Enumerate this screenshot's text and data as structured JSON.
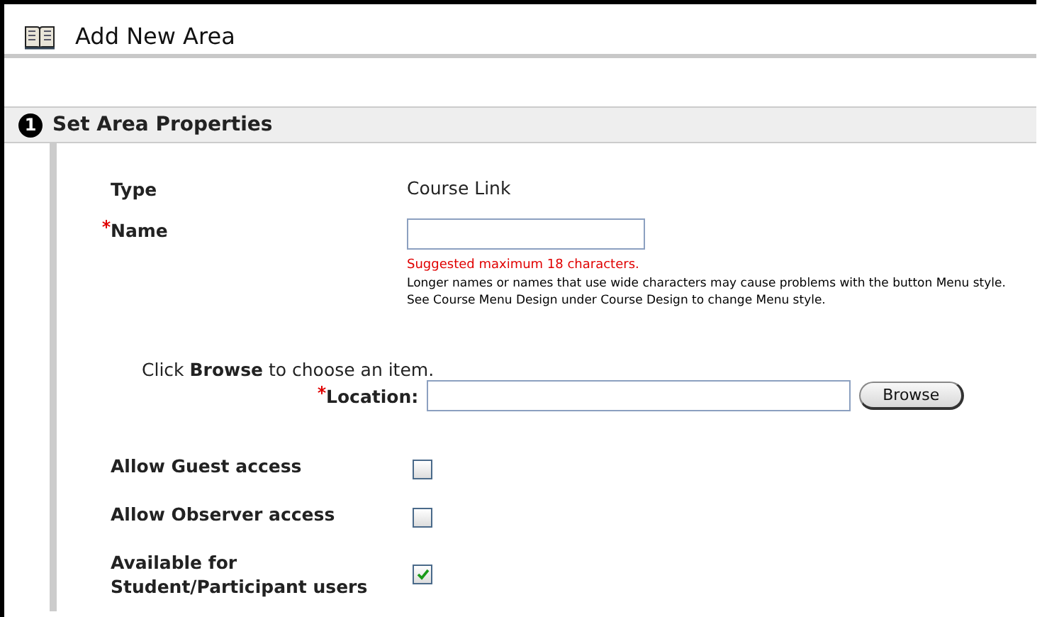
{
  "page": {
    "title": "Add New Area"
  },
  "section": {
    "number": "1",
    "title": "Set Area Properties"
  },
  "type_row": {
    "label": "Type",
    "value": "Course Link"
  },
  "name_field": {
    "label": "Name",
    "required": true,
    "warning": "Suggested maximum 18 characters.",
    "help": [
      "Longer names or names that use wide characters may cause problems with the button Menu style.",
      "See Course Menu Design under Course Design to change Menu style."
    ]
  },
  "location": {
    "instruction": "Click **Browse** to choose an item.",
    "label": "Location:",
    "required": true,
    "button": "Browse"
  },
  "options": [
    {
      "label": "Allow Guest access",
      "checked": false
    },
    {
      "label": "Allow Observer access",
      "checked": false
    },
    {
      "label": "Available for\nStudent/Participant users",
      "checked": true
    }
  ]
}
